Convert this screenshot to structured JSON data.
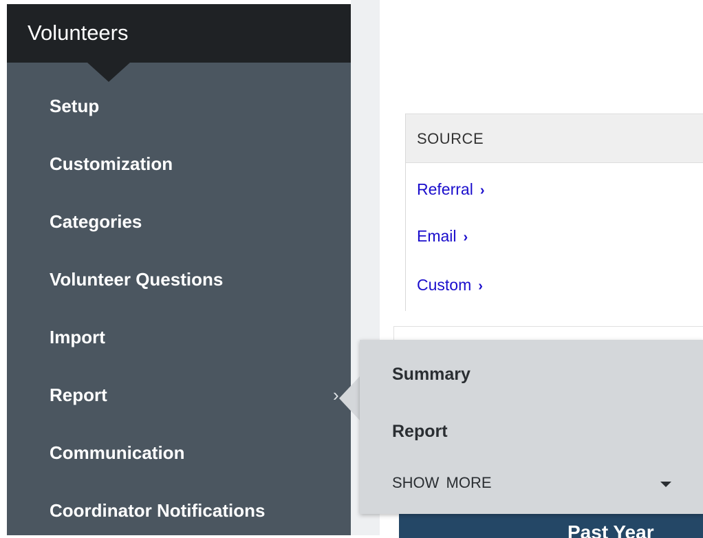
{
  "sidebar": {
    "title": "Volunteers",
    "items": [
      {
        "label": "Setup"
      },
      {
        "label": "Customization"
      },
      {
        "label": "Categories"
      },
      {
        "label": "Volunteer Questions"
      },
      {
        "label": "Import"
      },
      {
        "label": "Report",
        "chevron": "›"
      },
      {
        "label": "Communication"
      },
      {
        "label": "Coordinator Notifications"
      }
    ]
  },
  "source_panel": {
    "header": "SOURCE",
    "links": [
      {
        "label": "Referral",
        "chevron": "›"
      },
      {
        "label": "Email",
        "chevron": "›"
      },
      {
        "label": "Custom",
        "chevron": "›"
      }
    ]
  },
  "popover": {
    "items": [
      {
        "label": "Summary"
      },
      {
        "label": "Report"
      }
    ],
    "show_more": "SHOW MORE"
  },
  "bottom_button": {
    "label": "Past Year"
  },
  "colors": {
    "sidebar_bg": "#4b5660",
    "sidebar_header_bg": "#1f2225",
    "link": "#1a0dcc",
    "popover_bg": "#d4d7da",
    "button_bg": "#244766"
  }
}
